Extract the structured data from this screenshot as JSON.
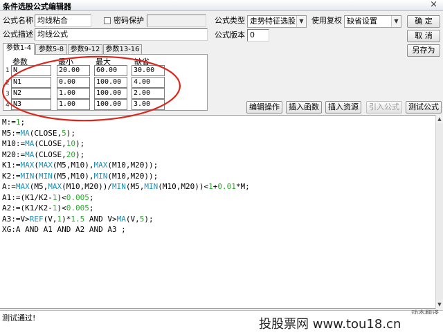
{
  "window": {
    "title": "条件选股公式编辑器",
    "close_glyph": "×"
  },
  "formula": {
    "name_label": "公式名称",
    "name_value": "均线粘合",
    "password_label": "密码保护",
    "password_checked": false,
    "desc_label": "公式描述",
    "desc_value": "均线公式",
    "type_label": "公式类型",
    "type_value": "走势特征选股",
    "use_label": "使用复权",
    "use_value": "缺省设置",
    "version_label": "公式版本",
    "version_value": "0"
  },
  "buttons": {
    "ok": "确 定",
    "cancel": "取 消",
    "save_as": "另存为",
    "edit_ops": "编辑操作",
    "insert_func": "插入函数",
    "insert_res": "插入资源",
    "import_formula": "引入公式",
    "test_formula": "测试公式"
  },
  "tabs": [
    {
      "label": "参数1-4",
      "active": true
    },
    {
      "label": "参数5-8",
      "active": false
    },
    {
      "label": "参数9-12",
      "active": false
    },
    {
      "label": "参数13-16",
      "active": false
    }
  ],
  "params": {
    "headers": [
      "参数",
      "最小",
      "最大",
      "缺省"
    ],
    "rows": [
      {
        "idx": "1",
        "name": "N",
        "min": "20.00",
        "max": "60.00",
        "default": "30.00"
      },
      {
        "idx": "2",
        "name": "N1",
        "min": "0.00",
        "max": "100.00",
        "default": "4.00"
      },
      {
        "idx": "3",
        "name": "N2",
        "min": "1.00",
        "max": "100.00",
        "default": "2.00"
      },
      {
        "idx": "4",
        "name": "N3",
        "min": "1.00",
        "max": "100.00",
        "default": "3.00"
      }
    ]
  },
  "code_lines": [
    "M:=1;",
    "M5:=MA(CLOSE,5);",
    "M10:=MA(CLOSE,10);",
    "M20:=MA(CLOSE,20);",
    "K1:=MAX(MAX(M5,M10),MAX(M10,M20));",
    "K2:=MIN(MIN(M5,M10),MIN(M10,M20));",
    "A:=MAX(M5,MAX(M10,M20))/MIN(M5,MIN(M10,M20))<1+0.01*M;",
    "A1:=(K1/K2-1)<0.005;",
    "A2:=(K1/K2-1)<0.005;",
    "A3:=V>REF(V,1)*1.5 AND V>MA(V,5);",
    "XG:A AND A1 AND A2 AND A3 ;"
  ],
  "status": {
    "message": "测试通过!",
    "right_text": "动态翻译"
  },
  "watermark": "投股票网  www.tou18.cn",
  "colors": {
    "function": "#1d8fb5",
    "number": "#2aa82a",
    "annotation": "#d9261c"
  }
}
